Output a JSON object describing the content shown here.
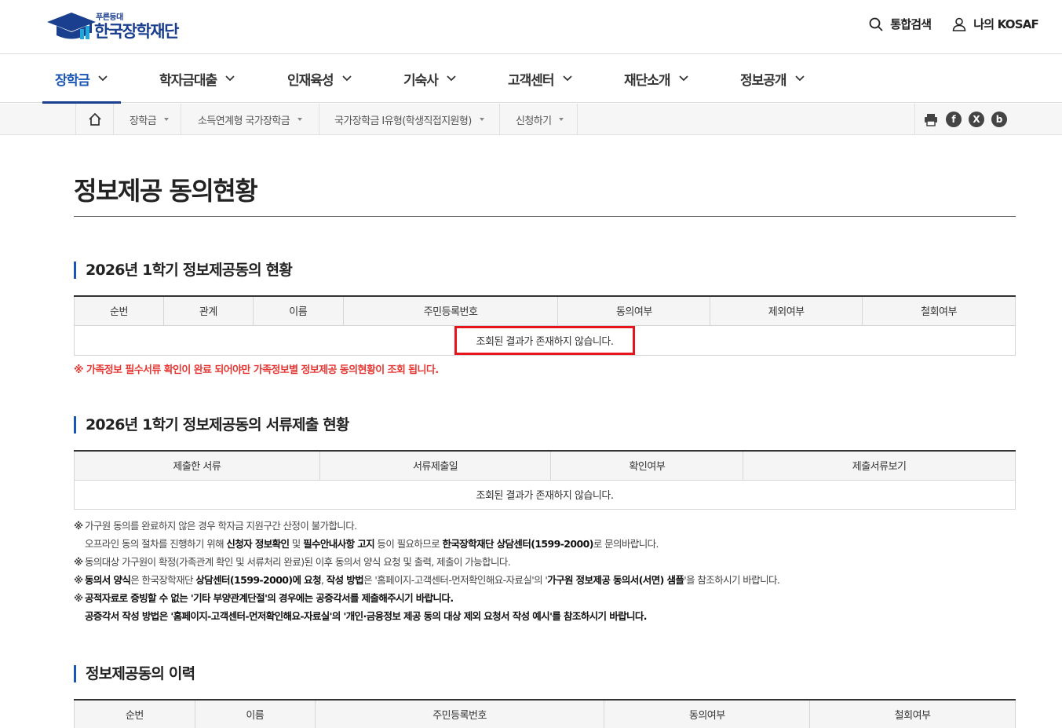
{
  "header": {
    "logo_small": "푸른등대",
    "logo_main": "한국장학재단",
    "search_label": "통합검색",
    "mykosaf_label": "나의 KOSAF"
  },
  "gnb": {
    "items": [
      {
        "label": "장학금"
      },
      {
        "label": "학자금대출"
      },
      {
        "label": "인재육성"
      },
      {
        "label": "기숙사"
      },
      {
        "label": "고객센터"
      },
      {
        "label": "재단소개"
      },
      {
        "label": "정보공개"
      }
    ]
  },
  "breadcrumb": {
    "items": [
      {
        "label": "장학금"
      },
      {
        "label": "소득연계형 국가장학금"
      },
      {
        "label": "국가장학금 I유형(학생직접지원형)"
      },
      {
        "label": "신청하기"
      }
    ]
  },
  "share": {
    "fb": "f",
    "x": "X",
    "blog": "b"
  },
  "page": {
    "title": "정보제공 동의현황"
  },
  "section1": {
    "title": "2026년 1학기 정보제공동의 현황",
    "headers": [
      "순번",
      "관계",
      "이름",
      "주민등록번호",
      "동의여부",
      "제외여부",
      "철회여부"
    ],
    "empty": "조회된 결과가 존재하지 않습니다.",
    "warning": "※ 가족정보 필수서류 확인이 완료 되어야만 가족정보별 정보제공 동의현황이 조회 됩니다."
  },
  "section2": {
    "title": "2026년 1학기 정보제공동의 서류제출 현황",
    "headers": [
      "제출한 서류",
      "서류제출일",
      "확인여부",
      "제출서류보기"
    ],
    "empty": "조회된 결과가 존재하지 않습니다."
  },
  "notes": {
    "mark": "※",
    "n1": "가구원 동의를 완료하지 않은 경우 학자금 지원구간 산정이 불가합니다.",
    "n2_a": "오프라인 동의 절차를 진행하기 위해 ",
    "n2_b": "신청자 정보확인",
    "n2_c": " 및 ",
    "n2_d": "필수안내사항 고지",
    "n2_e": " 등이 필요하므로 ",
    "n2_f": "한국장학재단 상담센터(1599-2000)",
    "n2_g": "로 문의바랍니다.",
    "n3": "동의대상 가구원이 확정(가족관계 확인 및 서류처리 완료)된 이후 동의서 양식 요청 및 출력, 제출이 가능합니다.",
    "n4_a": "동의서 양식",
    "n4_b": "은 한국장학재단 ",
    "n4_c": "상담센터(1599-2000)에 요청",
    "n4_d": ", ",
    "n4_e": "작성 방법",
    "n4_f": "은 '홈페이지-고객센터-먼저확인해요-자료실'의 '",
    "n4_g": "가구원 정보제공 동의서(서면) 샘플",
    "n4_h": "'을 참조하시기 바랍니다.",
    "n5": "공적자료로 증빙할 수 없는 '기타 부양관계단절'의 경우에는 공증각서를 제출해주시기 바랍니다.",
    "n6": "공증각서 작성 방법은 '홈페이지-고객센터-먼저확인해요-자료실'의 '개인·금융정보 제공 동의 대상 제외 요청서 작성 예시'를 참조하시기 바랍니다."
  },
  "section3": {
    "title": "정보제공동의 이력",
    "headers": [
      "순번",
      "이름",
      "주민등록번호",
      "동의여부",
      "철회여부"
    ]
  }
}
